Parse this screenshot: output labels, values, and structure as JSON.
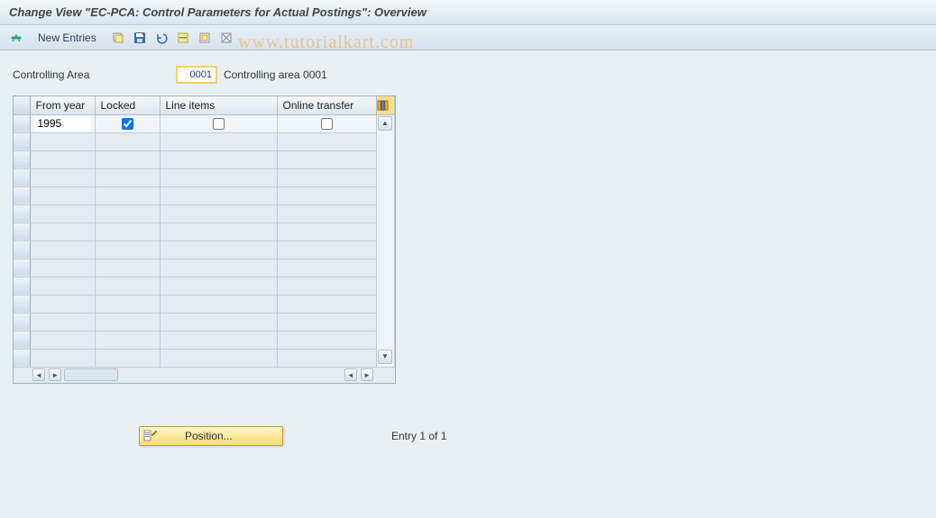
{
  "title": "Change View \"EC-PCA: Control Parameters for Actual Postings\": Overview",
  "toolbar": {
    "newEntries": "New Entries"
  },
  "watermark": "www.tutorialkart.com",
  "controllingArea": {
    "label": "Controlling Area",
    "value": "0001",
    "description": "Controlling area 0001"
  },
  "grid": {
    "columns": {
      "fromYear": "From year",
      "locked": "Locked",
      "lineItems": "Line items",
      "onlineTransfer": "Online transfer"
    },
    "rows": [
      {
        "fromYear": "1995",
        "locked": true,
        "lineItems": false,
        "onlineTransfer": false
      }
    ]
  },
  "footer": {
    "positionLabel": "Position...",
    "entryStatus": "Entry 1 of 1"
  }
}
